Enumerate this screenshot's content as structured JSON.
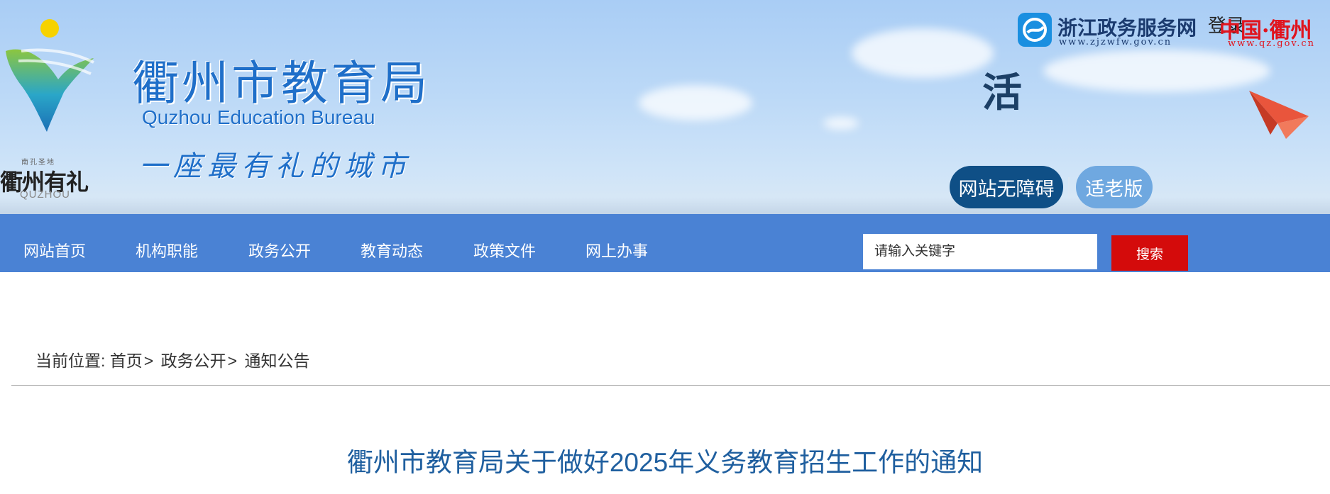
{
  "header": {
    "emblem": {
      "subtitle": "南孔圣地",
      "title": "衢州有礼",
      "english": "QUZHOU"
    },
    "site_title": "衢州市教育局",
    "site_title_en": "Quzhou Education Bureau",
    "slogan": "一座最有礼的城市",
    "ticker_text": "活",
    "zjzw": {
      "title": "浙江政务服务网",
      "url": "www.zjzwfw.gov.cn",
      "icon": "zjzw-logo-icon"
    },
    "login_label": "登录",
    "qz": {
      "title": "中国·衢州",
      "url": "www.qz.gov.cn"
    },
    "accessibility_label": "网站无障碍",
    "elder_label": "适老版"
  },
  "nav": {
    "items": [
      {
        "label": "网站首页"
      },
      {
        "label": "机构职能"
      },
      {
        "label": "政务公开"
      },
      {
        "label": "教育动态"
      },
      {
        "label": "政策文件"
      },
      {
        "label": "网上办事"
      }
    ]
  },
  "search": {
    "placeholder": "请输入关键字",
    "button_label": "搜索"
  },
  "breadcrumb": {
    "prefix": "当前位置:",
    "items": [
      "首页",
      "政务公开",
      "通知公告"
    ],
    "separator": ">"
  },
  "article": {
    "title": "衢州市教育局关于做好2025年义务教育招生工作的通知"
  },
  "colors": {
    "nav_bg": "#4a82d4",
    "search_button": "#d40b0b",
    "title_blue": "#1f5f9f",
    "brand_blue": "#1f6fc9",
    "accessibility_pill": "#0f4f86",
    "elder_pill": "#6fa8e0"
  }
}
